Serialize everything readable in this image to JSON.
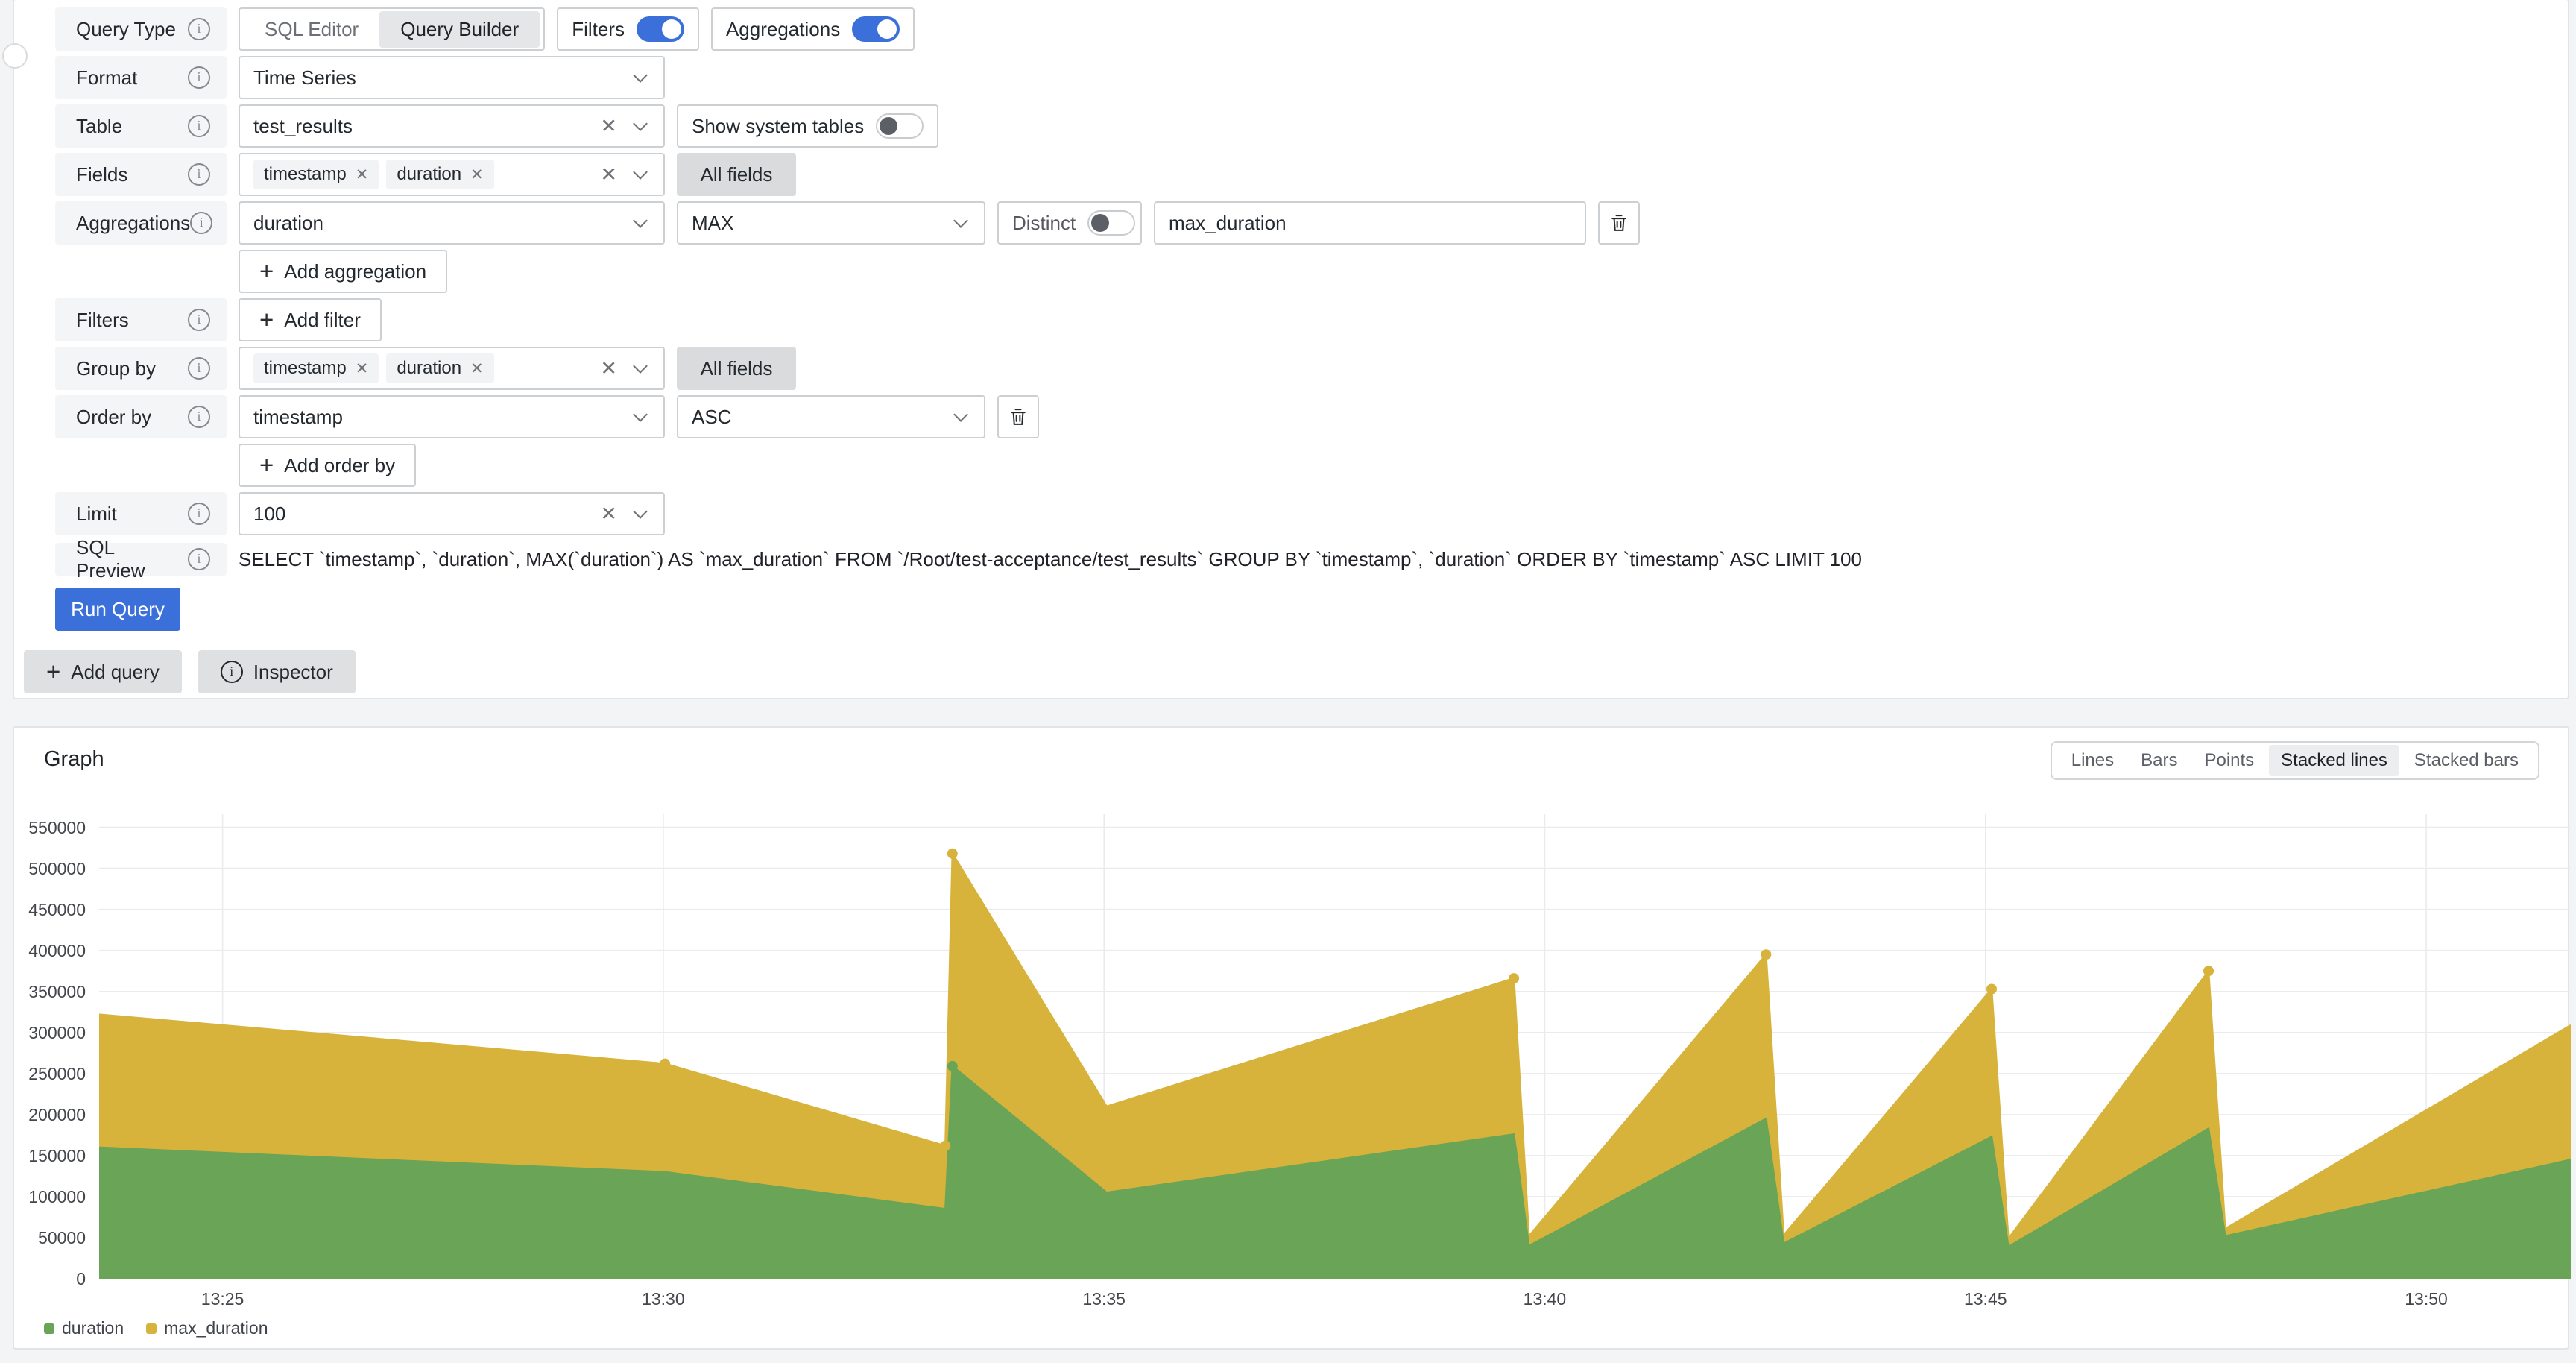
{
  "icons": {
    "close": "✕",
    "plus": "+",
    "info": "i"
  },
  "query_editor": {
    "query_type": {
      "label": "Query Type",
      "sql_editor": "SQL Editor",
      "query_builder": "Query Builder",
      "selected": "Query Builder",
      "filters_label": "Filters",
      "filters_on": true,
      "aggregations_label": "Aggregations",
      "aggregations_on": true
    },
    "format": {
      "label": "Format",
      "value": "Time Series"
    },
    "table": {
      "label": "Table",
      "value": "test_results",
      "system_tables_label": "Show system tables",
      "system_tables_on": false
    },
    "fields": {
      "label": "Fields",
      "chips": [
        "timestamp",
        "duration"
      ],
      "all_fields_label": "All fields"
    },
    "aggregations": {
      "label": "Aggregations",
      "column": "duration",
      "function": "MAX",
      "distinct_label": "Distinct",
      "distinct_on": false,
      "alias": "max_duration",
      "add_label": "Add aggregation"
    },
    "filters": {
      "label": "Filters",
      "add_label": "Add filter"
    },
    "group_by": {
      "label": "Group by",
      "chips": [
        "timestamp",
        "duration"
      ],
      "all_fields_label": "All fields"
    },
    "order_by": {
      "label": "Order by",
      "column": "timestamp",
      "direction": "ASC",
      "add_label": "Add order by"
    },
    "limit": {
      "label": "Limit",
      "value": "100"
    },
    "sql_preview": {
      "label": "SQL Preview",
      "sql": "SELECT `timestamp`, `duration`, MAX(`duration`) AS `max_duration` FROM `/Root/test-acceptance/test_results` GROUP BY `timestamp`, `duration` ORDER BY `timestamp` ASC LIMIT 100"
    },
    "run_query_label": "Run Query",
    "footer": {
      "add_query_label": "Add query",
      "inspector_label": "Inspector"
    }
  },
  "graph": {
    "title": "Graph",
    "modes": [
      "Lines",
      "Bars",
      "Points",
      "Stacked lines",
      "Stacked bars"
    ],
    "selected_mode": "Stacked lines"
  },
  "chart_data": {
    "type": "area",
    "stacked": true,
    "title": "Graph",
    "xlabel": "",
    "ylabel": "",
    "grid": true,
    "grid_color": "#EAEBEC",
    "legend_position": "bottom-left",
    "series_names": [
      "duration",
      "max_duration"
    ],
    "colors": {
      "duration": "#6AA457",
      "max_duration": "#D7B33B"
    },
    "x_range_minutes": [
      23.6,
      51.64
    ],
    "y_max": 566000,
    "y_ticks": [
      0,
      50000,
      100000,
      150000,
      200000,
      250000,
      300000,
      350000,
      400000,
      450000,
      500000,
      550000
    ],
    "x_ticks": [
      {
        "m": 25,
        "label": "13:25"
      },
      {
        "m": 30,
        "label": "13:30"
      },
      {
        "m": 35,
        "label": "13:35"
      },
      {
        "m": 40,
        "label": "13:40"
      },
      {
        "m": 45,
        "label": "13:45"
      },
      {
        "m": 50,
        "label": "13:50"
      }
    ],
    "points": [
      {
        "m": 23.6,
        "duration": 160000,
        "max_duration": 162000
      },
      {
        "m": 30.02,
        "duration": 130000,
        "max_duration": 132000,
        "dot": "total"
      },
      {
        "m": 33.2,
        "duration": 85000,
        "max_duration": 77000,
        "dot": "total"
      },
      {
        "m": 33.28,
        "duration": 259000,
        "max_duration": 259000,
        "dot": "both"
      },
      {
        "m": 35.03,
        "duration": 105000,
        "max_duration": 105000
      },
      {
        "m": 39.65,
        "duration": 176000,
        "max_duration": 190000,
        "dot": "total"
      },
      {
        "m": 39.82,
        "duration": 40000,
        "max_duration": 12000
      },
      {
        "m": 42.51,
        "duration": 195000,
        "max_duration": 200000,
        "dot": "total"
      },
      {
        "m": 42.71,
        "duration": 43000,
        "max_duration": 10000
      },
      {
        "m": 45.07,
        "duration": 173000,
        "max_duration": 180000,
        "dot": "total"
      },
      {
        "m": 45.26,
        "duration": 39000,
        "max_duration": 10000
      },
      {
        "m": 47.53,
        "duration": 183000,
        "max_duration": 192000,
        "dot": "total"
      },
      {
        "m": 47.72,
        "duration": 52000,
        "max_duration": 9000
      },
      {
        "m": 51.64,
        "duration": 145000,
        "max_duration": 164000
      }
    ],
    "legend": [
      "duration",
      "max_duration"
    ]
  }
}
